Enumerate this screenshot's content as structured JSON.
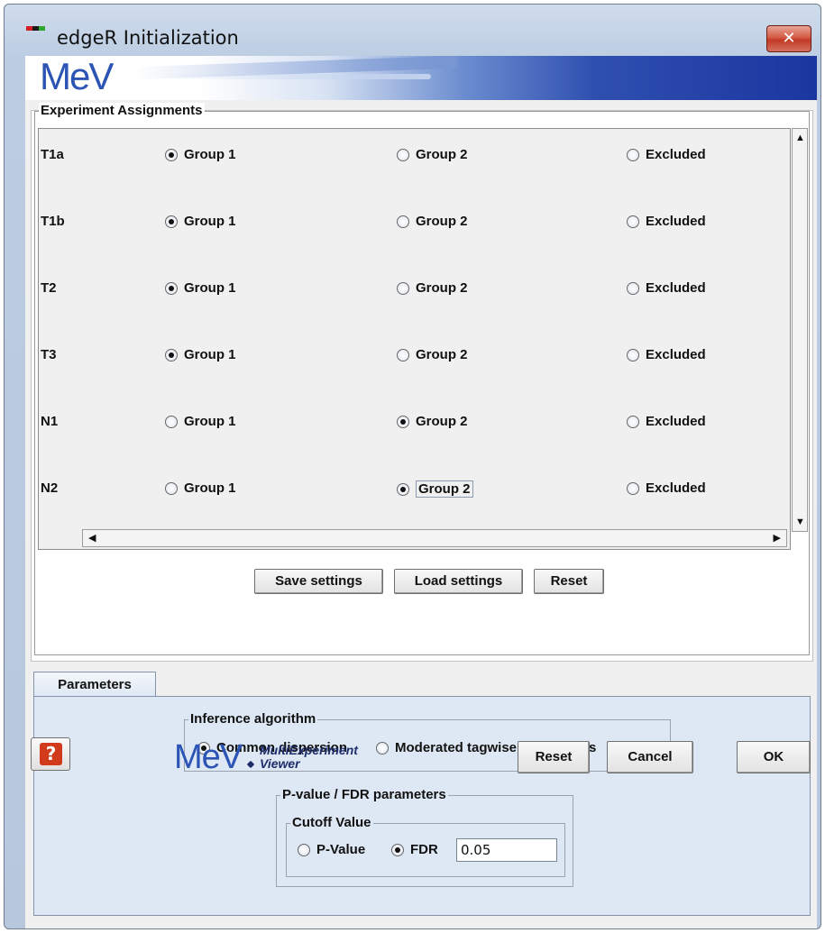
{
  "window": {
    "title": "edgeR Initialization",
    "close_glyph": "✕"
  },
  "banner": {
    "logo": "MeV"
  },
  "assignments": {
    "title": "Experiment Assignments",
    "options": [
      "Group 1",
      "Group 2",
      "Excluded"
    ],
    "rows": [
      {
        "label": "T1a",
        "selected": 0
      },
      {
        "label": "T1b",
        "selected": 0
      },
      {
        "label": "T2",
        "selected": 0
      },
      {
        "label": "T3",
        "selected": 0
      },
      {
        "label": "N1",
        "selected": 1
      },
      {
        "label": "N2",
        "selected": 1
      }
    ],
    "buttons": {
      "save": "Save settings",
      "load": "Load settings",
      "reset": "Reset"
    }
  },
  "parameters": {
    "tab_label": "Parameters",
    "inference": {
      "title": "Inference algorithm",
      "options": [
        "Common dispersion",
        "Moderated tagwise dispersions"
      ],
      "selected": 0
    },
    "pvalue": {
      "title": "P-value / FDR parameters",
      "cutoff_title": "Cutoff Value",
      "options": [
        "P-Value",
        "FDR"
      ],
      "selected": 1,
      "value": "0.05"
    }
  },
  "footer": {
    "help_glyph": "?",
    "logo": "MeV",
    "logo_sub_1": "MultiExperiment",
    "logo_sub_2": "Viewer",
    "reset": "Reset",
    "cancel": "Cancel",
    "ok": "OK"
  },
  "icons": {
    "app": "mev-app-icon",
    "close": "close-icon",
    "help": "help-icon",
    "scroll_up": "up-arrow-icon",
    "scroll_down": "down-arrow-icon",
    "scroll_left": "left-arrow-icon",
    "scroll_right": "right-arrow-icon"
  },
  "colors": {
    "accent": "#2c54b4",
    "close": "#c23a25",
    "help": "#d13b1b"
  }
}
